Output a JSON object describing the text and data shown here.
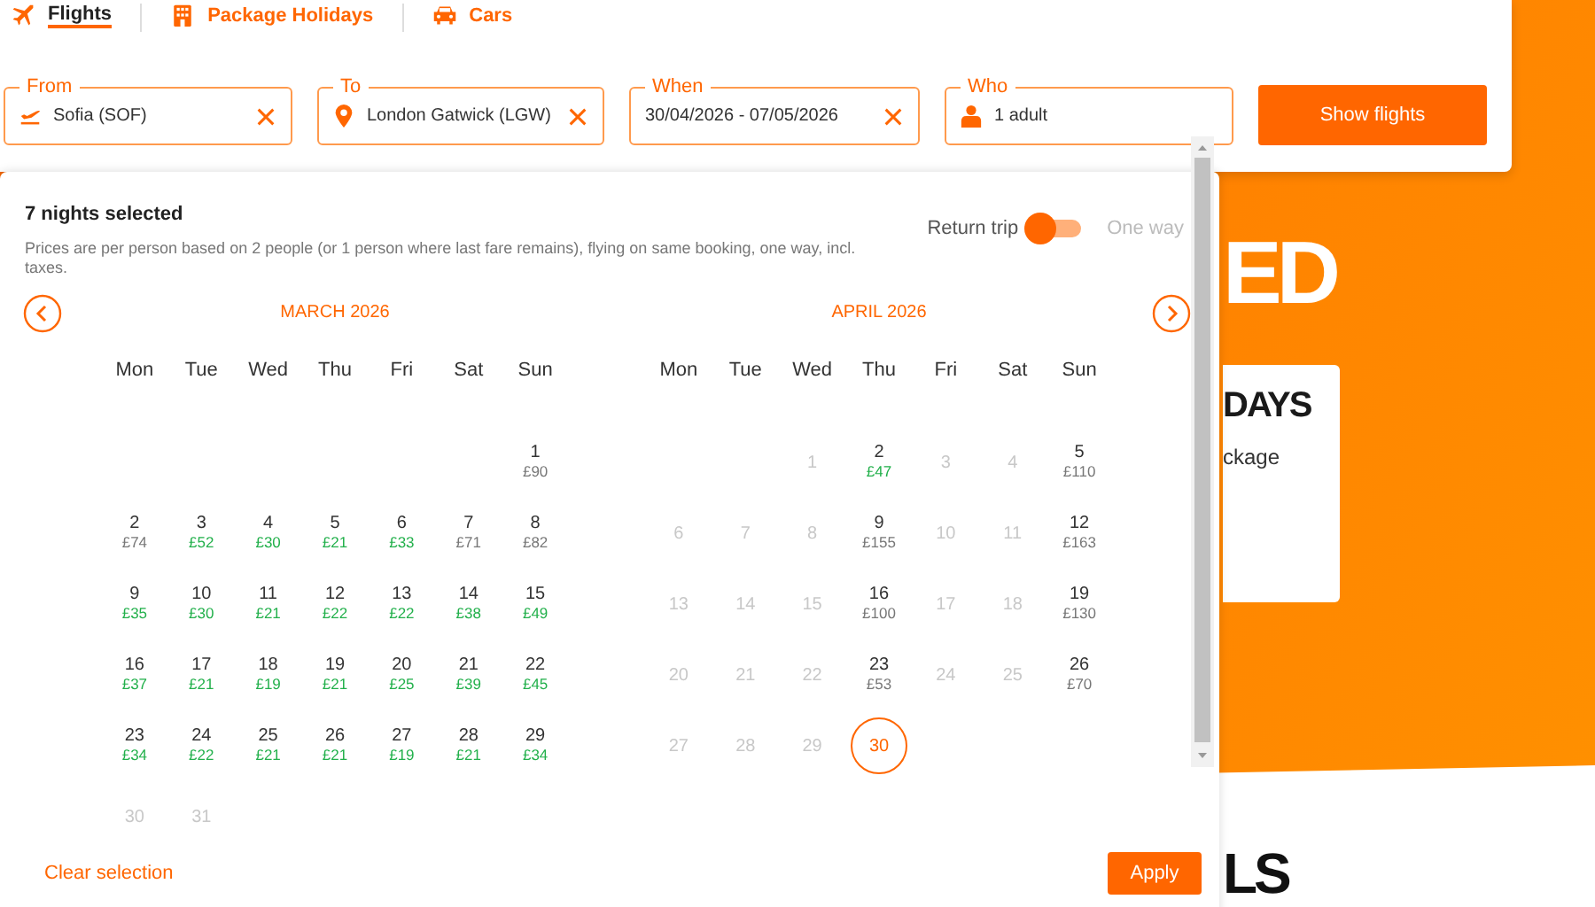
{
  "tabs": [
    {
      "label": "Flights",
      "selected": true
    },
    {
      "label": "Package Holidays",
      "selected": false
    },
    {
      "label": "Cars",
      "selected": false
    }
  ],
  "fields": [
    {
      "label": "From",
      "value": "Sofia (SOF)",
      "clearable": true
    },
    {
      "label": "To",
      "value": "London Gatwick (LGW)",
      "clearable": true
    },
    {
      "label": "When",
      "value": "30/04/2026 - 07/05/2026",
      "clearable": true
    },
    {
      "label": "Who",
      "value": "1 adult",
      "clearable": false
    }
  ],
  "search_button": "Show flights",
  "hero": {
    "heading": "ED",
    "card_title": "DAYS",
    "card_text": "ckage",
    "section_heading": "LS"
  },
  "calendar": {
    "title": "7 nights selected",
    "note": "Prices are per person based on 2 people (or 1 person where last fare remains), flying on same booking, one way, incl. taxes.",
    "trip_options": [
      {
        "label": "Return trip",
        "selected": true
      },
      {
        "label": "One way",
        "selected": false
      }
    ],
    "months": [
      {
        "title": "MARCH 2026",
        "weekdays": [
          "Mon",
          "Tue",
          "Wed",
          "Thu",
          "Fri",
          "Sat",
          "Sun"
        ],
        "weeks": [
          [
            {
              "kind": "blank"
            },
            {
              "kind": "blank"
            },
            {
              "kind": "blank"
            },
            {
              "kind": "blank"
            },
            {
              "kind": "blank"
            },
            {
              "kind": "blank"
            },
            {
              "kind": "day",
              "day": "1",
              "price": "£90",
              "cheap": false,
              "disabled": false,
              "selected": false
            }
          ],
          [
            {
              "kind": "day",
              "day": "2",
              "price": "£74",
              "cheap": false,
              "disabled": false,
              "selected": false
            },
            {
              "kind": "day",
              "day": "3",
              "price": "£52",
              "cheap": true,
              "disabled": false,
              "selected": false
            },
            {
              "kind": "day",
              "day": "4",
              "price": "£30",
              "cheap": true,
              "disabled": false,
              "selected": false
            },
            {
              "kind": "day",
              "day": "5",
              "price": "£21",
              "cheap": true,
              "disabled": false,
              "selected": false
            },
            {
              "kind": "day",
              "day": "6",
              "price": "£33",
              "cheap": true,
              "disabled": false,
              "selected": false
            },
            {
              "kind": "day",
              "day": "7",
              "price": "£71",
              "cheap": false,
              "disabled": false,
              "selected": false
            },
            {
              "kind": "day",
              "day": "8",
              "price": "£82",
              "cheap": false,
              "disabled": false,
              "selected": false
            }
          ],
          [
            {
              "kind": "day",
              "day": "9",
              "price": "£35",
              "cheap": true,
              "disabled": false,
              "selected": false
            },
            {
              "kind": "day",
              "day": "10",
              "price": "£30",
              "cheap": true,
              "disabled": false,
              "selected": false
            },
            {
              "kind": "day",
              "day": "11",
              "price": "£21",
              "cheap": true,
              "disabled": false,
              "selected": false
            },
            {
              "kind": "day",
              "day": "12",
              "price": "£22",
              "cheap": true,
              "disabled": false,
              "selected": false
            },
            {
              "kind": "day",
              "day": "13",
              "price": "£22",
              "cheap": true,
              "disabled": false,
              "selected": false
            },
            {
              "kind": "day",
              "day": "14",
              "price": "£38",
              "cheap": true,
              "disabled": false,
              "selected": false
            },
            {
              "kind": "day",
              "day": "15",
              "price": "£49",
              "cheap": true,
              "disabled": false,
              "selected": false
            }
          ],
          [
            {
              "kind": "day",
              "day": "16",
              "price": "£37",
              "cheap": true,
              "disabled": false,
              "selected": false
            },
            {
              "kind": "day",
              "day": "17",
              "price": "£21",
              "cheap": true,
              "disabled": false,
              "selected": false
            },
            {
              "kind": "day",
              "day": "18",
              "price": "£19",
              "cheap": true,
              "disabled": false,
              "selected": false
            },
            {
              "kind": "day",
              "day": "19",
              "price": "£21",
              "cheap": true,
              "disabled": false,
              "selected": false
            },
            {
              "kind": "day",
              "day": "20",
              "price": "£25",
              "cheap": true,
              "disabled": false,
              "selected": false
            },
            {
              "kind": "day",
              "day": "21",
              "price": "£39",
              "cheap": true,
              "disabled": false,
              "selected": false
            },
            {
              "kind": "day",
              "day": "22",
              "price": "£45",
              "cheap": true,
              "disabled": false,
              "selected": false
            }
          ],
          [
            {
              "kind": "day",
              "day": "23",
              "price": "£34",
              "cheap": true,
              "disabled": false,
              "selected": false
            },
            {
              "kind": "day",
              "day": "24",
              "price": "£22",
              "cheap": true,
              "disabled": false,
              "selected": false
            },
            {
              "kind": "day",
              "day": "25",
              "price": "£21",
              "cheap": true,
              "disabled": false,
              "selected": false
            },
            {
              "kind": "day",
              "day": "26",
              "price": "£21",
              "cheap": true,
              "disabled": false,
              "selected": false
            },
            {
              "kind": "day",
              "day": "27",
              "price": "£19",
              "cheap": true,
              "disabled": false,
              "selected": false
            },
            {
              "kind": "day",
              "day": "28",
              "price": "£21",
              "cheap": true,
              "disabled": false,
              "selected": false
            },
            {
              "kind": "day",
              "day": "29",
              "price": "£34",
              "cheap": true,
              "disabled": false,
              "selected": false
            }
          ],
          [
            {
              "kind": "day",
              "day": "30",
              "disabled": true,
              "selected": false
            },
            {
              "kind": "day",
              "day": "31",
              "disabled": true,
              "selected": false
            },
            {
              "kind": "blank"
            },
            {
              "kind": "blank"
            },
            {
              "kind": "blank"
            },
            {
              "kind": "blank"
            },
            {
              "kind": "blank"
            }
          ]
        ]
      },
      {
        "title": "APRIL 2026",
        "weekdays": [
          "Mon",
          "Tue",
          "Wed",
          "Thu",
          "Fri",
          "Sat",
          "Sun"
        ],
        "weeks": [
          [
            {
              "kind": "blank"
            },
            {
              "kind": "blank"
            },
            {
              "kind": "day",
              "day": "1",
              "disabled": true,
              "selected": false
            },
            {
              "kind": "day",
              "day": "2",
              "price": "£47",
              "cheap": true,
              "disabled": false,
              "selected": false
            },
            {
              "kind": "day",
              "day": "3",
              "disabled": true,
              "selected": false
            },
            {
              "kind": "day",
              "day": "4",
              "disabled": true,
              "selected": false
            },
            {
              "kind": "day",
              "day": "5",
              "price": "£110",
              "cheap": false,
              "disabled": false,
              "selected": false
            }
          ],
          [
            {
              "kind": "day",
              "day": "6",
              "disabled": true,
              "selected": false
            },
            {
              "kind": "day",
              "day": "7",
              "disabled": true,
              "selected": false
            },
            {
              "kind": "day",
              "day": "8",
              "disabled": true,
              "selected": false
            },
            {
              "kind": "day",
              "day": "9",
              "price": "£155",
              "cheap": false,
              "disabled": false,
              "selected": false
            },
            {
              "kind": "day",
              "day": "10",
              "disabled": true,
              "selected": false
            },
            {
              "kind": "day",
              "day": "11",
              "disabled": true,
              "selected": false
            },
            {
              "kind": "day",
              "day": "12",
              "price": "£163",
              "cheap": false,
              "disabled": false,
              "selected": false
            }
          ],
          [
            {
              "kind": "day",
              "day": "13",
              "disabled": true,
              "selected": false
            },
            {
              "kind": "day",
              "day": "14",
              "disabled": true,
              "selected": false
            },
            {
              "kind": "day",
              "day": "15",
              "disabled": true,
              "selected": false
            },
            {
              "kind": "day",
              "day": "16",
              "price": "£100",
              "cheap": false,
              "disabled": false,
              "selected": false
            },
            {
              "kind": "day",
              "day": "17",
              "disabled": true,
              "selected": false
            },
            {
              "kind": "day",
              "day": "18",
              "disabled": true,
              "selected": false
            },
            {
              "kind": "day",
              "day": "19",
              "price": "£130",
              "cheap": false,
              "disabled": false,
              "selected": false
            }
          ],
          [
            {
              "kind": "day",
              "day": "20",
              "disabled": true,
              "selected": false
            },
            {
              "kind": "day",
              "day": "21",
              "disabled": true,
              "selected": false
            },
            {
              "kind": "day",
              "day": "22",
              "disabled": true,
              "selected": false
            },
            {
              "kind": "day",
              "day": "23",
              "price": "£53",
              "cheap": false,
              "disabled": false,
              "selected": false
            },
            {
              "kind": "day",
              "day": "24",
              "disabled": true,
              "selected": false
            },
            {
              "kind": "day",
              "day": "25",
              "disabled": true,
              "selected": false
            },
            {
              "kind": "day",
              "day": "26",
              "price": "£70",
              "cheap": false,
              "disabled": false,
              "selected": false
            }
          ],
          [
            {
              "kind": "day",
              "day": "27",
              "disabled": true,
              "selected": false
            },
            {
              "kind": "day",
              "day": "28",
              "disabled": true,
              "selected": false
            },
            {
              "kind": "day",
              "day": "29",
              "disabled": true,
              "selected": false
            },
            {
              "kind": "day",
              "day": "30",
              "disabled": false,
              "selected": true
            },
            {
              "kind": "blank"
            },
            {
              "kind": "blank"
            },
            {
              "kind": "blank"
            }
          ]
        ]
      }
    ],
    "clear_label": "Clear selection",
    "apply_label": "Apply"
  }
}
